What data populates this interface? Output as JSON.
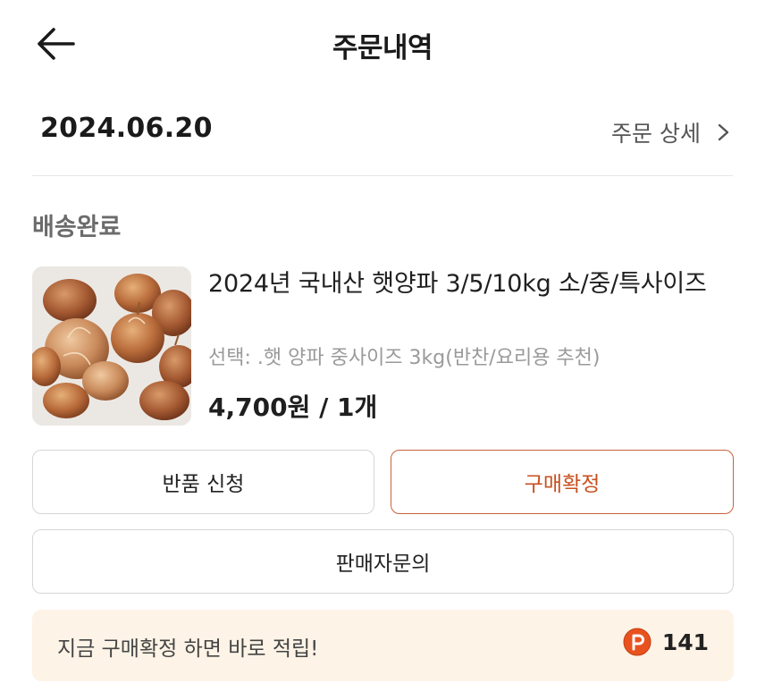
{
  "header": {
    "title": "주문내역"
  },
  "order": {
    "date": "2024.06.20",
    "detail_link": "주문 상세",
    "status": "배송완료"
  },
  "product": {
    "name": "2024년 국내산 햇양파 3/5/10kg 소/중/특사이즈",
    "option": "선택: .햇 양파 중사이즈 3kg(반찬/요리용 추천)",
    "price": "4,700원 / 1개"
  },
  "buttons": {
    "return_label": "반품 신청",
    "confirm_label": "구매확정",
    "inquiry_label": "판매자문의"
  },
  "banner": {
    "text": "지금 구매확정 하면 바로 적립!",
    "points": "141"
  },
  "icons": {
    "back": "arrow-left-icon",
    "detail": "chevron-right-icon",
    "points": "points-p-icon"
  },
  "colors": {
    "accent": "#c8501f",
    "banner_bg": "#fdf3e6",
    "points_icon": "#e8521e"
  }
}
